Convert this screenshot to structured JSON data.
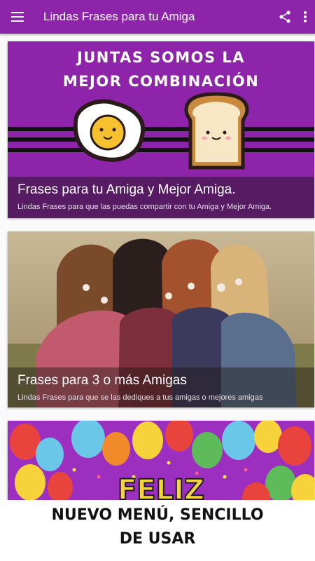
{
  "app_bar": {
    "title": "Lindas Frases para tu Amiga",
    "menu_icon": "hamburger-menu-icon",
    "share_icon": "share-icon",
    "more_icon": "more-vertical-icon",
    "color": "#8e24aa"
  },
  "cards": [
    {
      "banner_line1": "JUNTAS SOMOS LA",
      "banner_line2": "MEJOR COMBINACIÓN",
      "title": "Frases para tu Amiga y Mejor Amiga.",
      "description": "Lindas Frases para que las puedas compartir con tu Amiga y Mejor Amiga."
    },
    {
      "title": "Frases para 3 o más Amigas",
      "description": "Lindas Frases para que se las dediques a tus amigas o mejores amigas"
    },
    {
      "banner_text": "FELIZ"
    }
  ],
  "promo": {
    "line1": "NUEVO MENÚ, SENCILLO",
    "line2": "DE USAR"
  }
}
